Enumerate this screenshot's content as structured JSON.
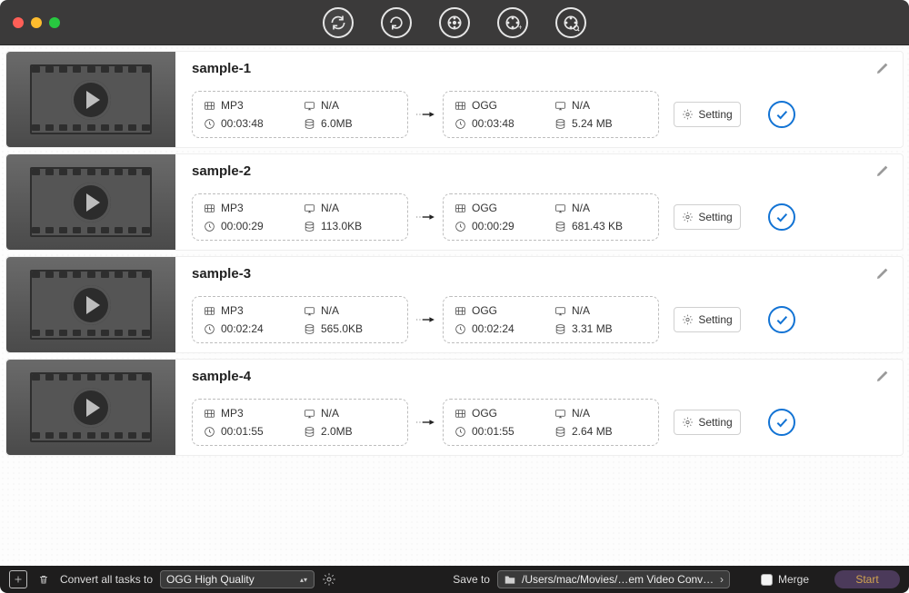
{
  "toolbar": {
    "icons": [
      "refresh-icon",
      "refresh-down-icon",
      "film-gear-icon",
      "film-plus-icon",
      "film-search-icon"
    ]
  },
  "setting_label": "Setting",
  "tasks": [
    {
      "title": "sample-1",
      "src": {
        "format": "MP3",
        "resolution": "N/A",
        "duration": "00:03:48",
        "size": "6.0MB"
      },
      "dst": {
        "format": "OGG",
        "resolution": "N/A",
        "duration": "00:03:48",
        "size": "5.24 MB"
      }
    },
    {
      "title": "sample-2",
      "src": {
        "format": "MP3",
        "resolution": "N/A",
        "duration": "00:00:29",
        "size": "113.0KB"
      },
      "dst": {
        "format": "OGG",
        "resolution": "N/A",
        "duration": "00:00:29",
        "size": "681.43 KB"
      }
    },
    {
      "title": "sample-3",
      "src": {
        "format": "MP3",
        "resolution": "N/A",
        "duration": "00:02:24",
        "size": "565.0KB"
      },
      "dst": {
        "format": "OGG",
        "resolution": "N/A",
        "duration": "00:02:24",
        "size": "3.31 MB"
      }
    },
    {
      "title": "sample-4",
      "src": {
        "format": "MP3",
        "resolution": "N/A",
        "duration": "00:01:55",
        "size": "2.0MB"
      },
      "dst": {
        "format": "OGG",
        "resolution": "N/A",
        "duration": "00:01:55",
        "size": "2.64 MB"
      }
    }
  ],
  "footer": {
    "convert_label": "Convert all tasks to",
    "preset": "OGG High Quality",
    "save_label": "Save to",
    "save_path": "/Users/mac/Movies/…em Video Converter",
    "merge_label": "Merge",
    "start_label": "Start"
  }
}
